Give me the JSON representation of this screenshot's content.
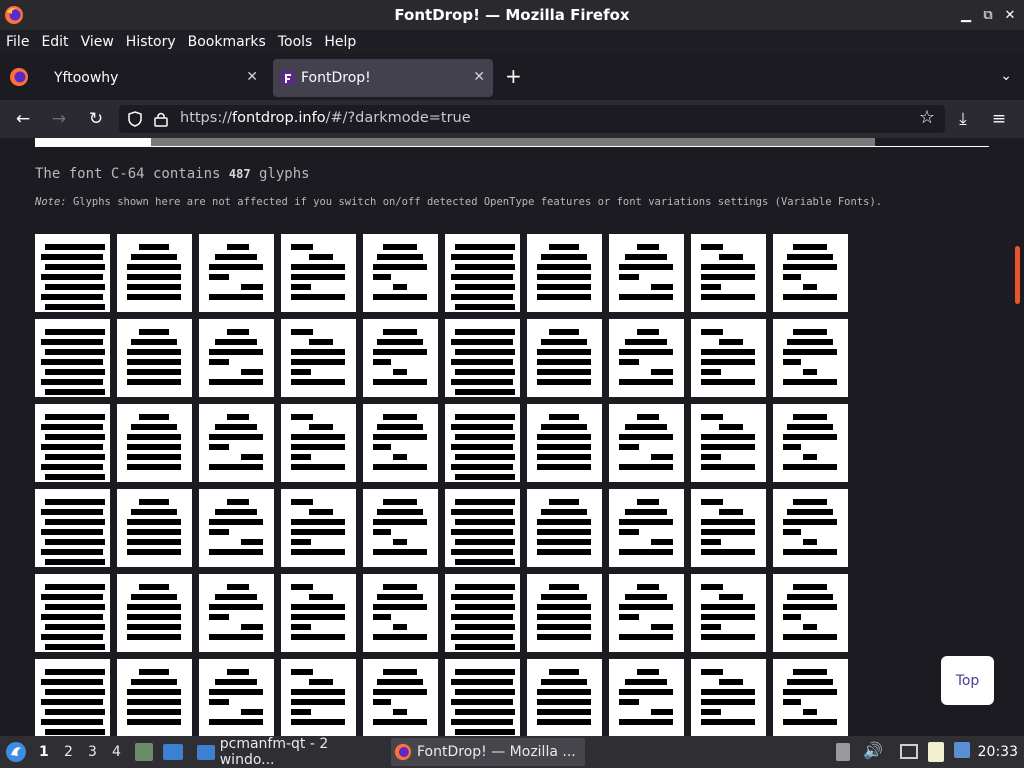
{
  "window": {
    "title": "FontDrop! — Mozilla Firefox"
  },
  "menu": [
    "File",
    "Edit",
    "View",
    "History",
    "Bookmarks",
    "Tools",
    "Help"
  ],
  "tabs": [
    {
      "label": "Yftoowhy",
      "close": "✕"
    },
    {
      "label": "FontDrop!",
      "close": "✕"
    }
  ],
  "toolbar": {
    "new_tab": "+",
    "tab_list": "⌄"
  },
  "url": {
    "prefix": "https://",
    "domain": "fontdrop.info",
    "path": "/#/?darkmode=true"
  },
  "page": {
    "heading_prefix": "The font C-64 contains",
    "glyph_count": "487",
    "heading_suffix": "glyphs",
    "note_label": "Note:",
    "note_text": "Glyphs shown here are not affected if you switch on/off detected OpenType features or font variations settings (Variable Fonts).",
    "top_button": "Top"
  },
  "glyph_icons": [
    [
      "notdef-glyph",
      "a-grave-glyph",
      "a-acute-glyph",
      "a-circumflex-glyph",
      "a-tilde-glyph",
      "a-diaeresis-glyph",
      "a-ring-glyph",
      "ae-glyph",
      "b-glyph",
      "c-glyph"
    ],
    [
      "c-cedilla-glyph",
      "d-glyph",
      "eth-glyph",
      "e-glyph",
      "e-grave-glyph",
      "e-acute-glyph",
      "e-circumflex-glyph",
      "f-glyph",
      "g-glyph",
      "h-glyph"
    ],
    [
      "i-glyph",
      "i-grave-glyph",
      "i-acute-glyph",
      "i-circumflex-glyph",
      "i-diaeresis-glyph",
      "j-glyph",
      "k-glyph",
      "l-glyph",
      "m-glyph",
      "n-glyph"
    ],
    [
      "o-glyph",
      "o-grave-glyph",
      "o-acute-glyph",
      "o-circumflex-glyph",
      "o-tilde-glyph",
      "o-diaeresis-glyph",
      "o-stroke-glyph",
      "oe-glyph",
      "p-glyph",
      "thorn-glyph"
    ],
    [
      "q-glyph",
      "r-glyph",
      "s-glyph",
      "t-glyph",
      "u-glyph",
      "u-grave-glyph",
      "u-acute-glyph",
      "u-circumflex-glyph",
      "v-glyph",
      "w-glyph"
    ],
    [
      "x-glyph",
      "y-glyph",
      "y-acute-glyph",
      "z-glyph",
      "a-small-glyph",
      "i-small-glyph",
      "u-small-glyph",
      "a-small-2-glyph",
      "e-small-glyph",
      "z-small-glyph"
    ]
  ],
  "taskbar": {
    "workspaces": [
      "1",
      "2",
      "3",
      "4"
    ],
    "tasks": [
      "pcmanfm-qt - 2 windo...",
      "FontDrop! — Mozilla ..."
    ],
    "clock": "20:33"
  },
  "colors": {
    "accent": "#e8552c",
    "background": "#1c1b22",
    "glyph_bg": "#ffffff"
  }
}
